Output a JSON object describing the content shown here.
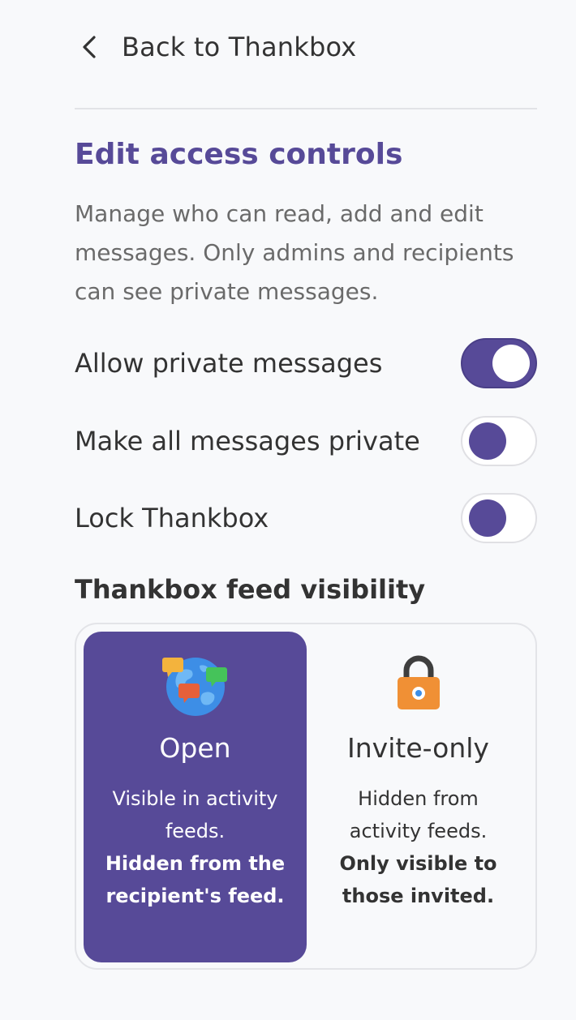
{
  "nav": {
    "back_label": "Back to Thankbox",
    "back_icon": "chevron-left-icon"
  },
  "header": {
    "title": "Edit access controls",
    "description": "Manage who can read, add and edit messages. Only admins and recipients can see private messages."
  },
  "toggles": [
    {
      "label": "Allow private messages",
      "on": true
    },
    {
      "label": "Make all messages private",
      "on": false
    },
    {
      "label": "Lock Thankbox",
      "on": false
    }
  ],
  "visibility": {
    "heading": "Thankbox feed visibility",
    "options": [
      {
        "title": "Open",
        "icon": "globe-chat-icon",
        "desc": "Visible in activity feeds.",
        "desc_bold": "Hidden from the recipient's feed.",
        "selected": true
      },
      {
        "title": "Invite-only",
        "icon": "padlock-icon",
        "desc": "Hidden from activity feeds.",
        "desc_bold": "Only visible to those invited.",
        "selected": false
      }
    ]
  },
  "colors": {
    "accent": "#574a98",
    "background": "#f8f9fb",
    "text": "#333333",
    "muted_text": "#6a6a6a"
  }
}
